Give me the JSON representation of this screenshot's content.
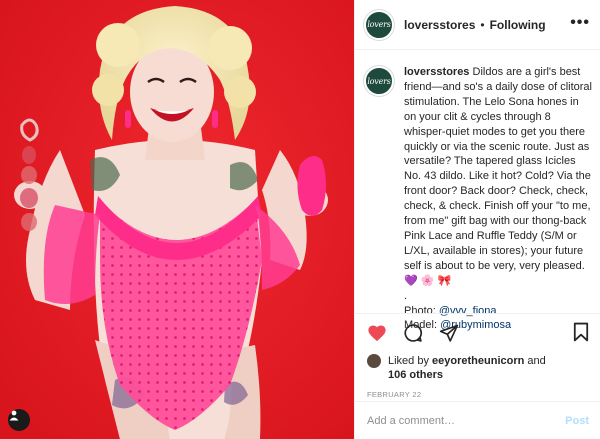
{
  "post": {
    "username": "loversstores",
    "follow_status": "Following",
    "more_label": "•••",
    "avatar_text": "lovers",
    "caption": {
      "username": "loversstores",
      "text_part1": "Dildos are a girl's best friend—and so's a daily dose of clitoral stimulation. The Lelo Sona hones in on your clit & cycles through 8 whisper-quiet modes to get you there quickly or via the scenic route. Just as versatile? The tapered glass Icicles No. 43 dildo. Like it hot? Cold? Via the front door? Back door? Check, check, check, & check. Finish off your \"to me, from me\" gift bag with our thong-back Pink Lace and Ruffle Teddy (S/M or L/XL, available in stores); your future self is about to be very, very pleased.",
      "emoji_heart": "💜",
      "emoji_flower": "🌸",
      "emoji_bow": "🎀",
      "separator": ".",
      "photo_label": "Photo: ",
      "photo_handle": "@vvv_fiona",
      "model_label": "Model: ",
      "model_handle": "@rubymimosa"
    },
    "likes": {
      "liked_by_prefix": "Liked by ",
      "liked_by_user": "eeyoretheunicorn",
      "and_word": " and",
      "others_count": "106 others"
    },
    "date": "FEBRUARY 22",
    "comment": {
      "placeholder": "Add a comment…",
      "post_label": "Post"
    }
  },
  "icons": {
    "like": "heart-icon",
    "comment": "comment-bubble-icon",
    "share": "paper-plane-icon",
    "save": "bookmark-icon",
    "tag": "user-tag-icon"
  },
  "colors": {
    "like_red": "#ed4956",
    "post_disabled_blue": "#b2dffc",
    "link_blue": "#003569",
    "photo_background_red": "#e8202a",
    "avatar_green": "#1e4a3d"
  }
}
